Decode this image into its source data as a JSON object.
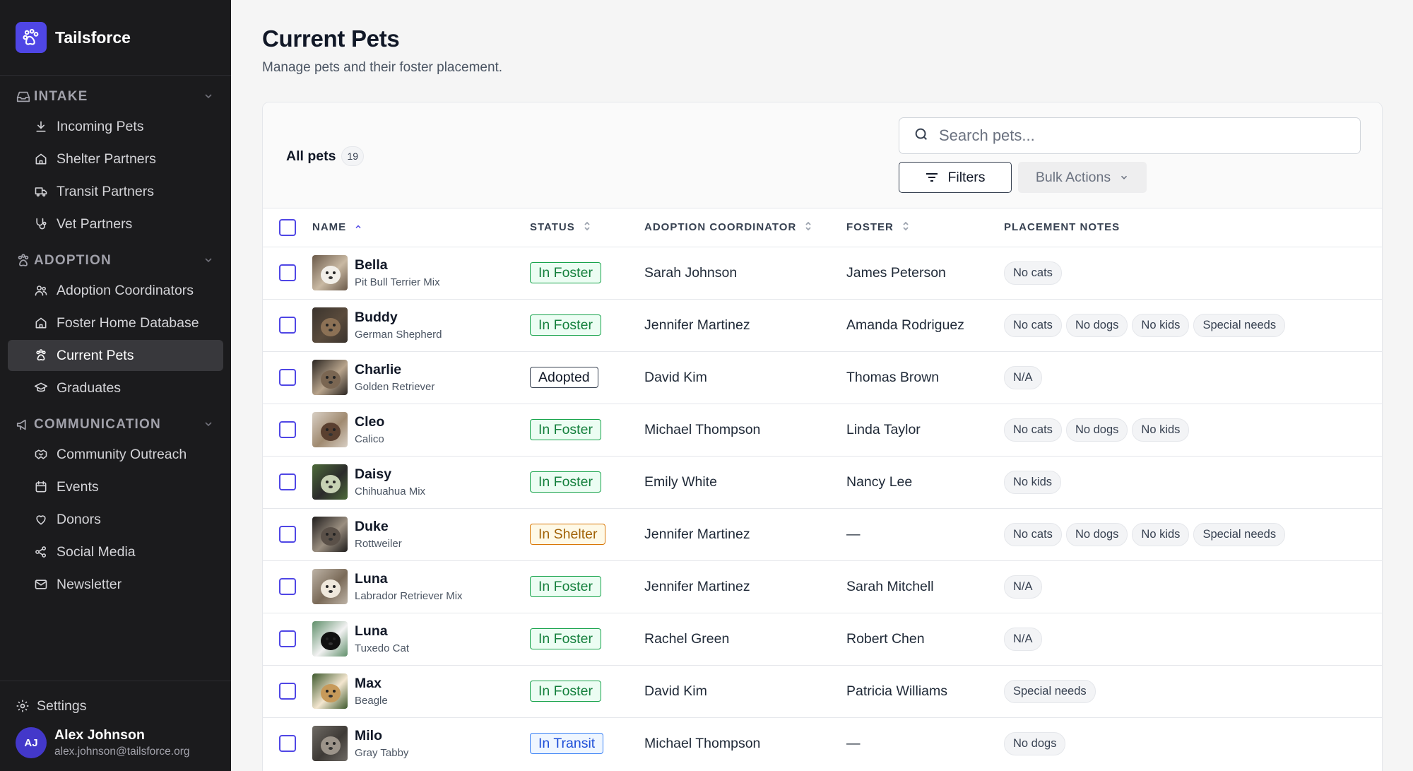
{
  "app": {
    "name": "Tailsforce"
  },
  "sidebar": {
    "sections": [
      {
        "label": "INTAKE",
        "icon": "inbox-icon",
        "items": [
          {
            "label": "Incoming Pets",
            "icon": "download-icon"
          },
          {
            "label": "Shelter Partners",
            "icon": "home-icon"
          },
          {
            "label": "Transit Partners",
            "icon": "truck-icon"
          },
          {
            "label": "Vet Partners",
            "icon": "stethoscope-icon"
          }
        ]
      },
      {
        "label": "ADOPTION",
        "icon": "paw-icon",
        "items": [
          {
            "label": "Adoption Coordinators",
            "icon": "users-icon"
          },
          {
            "label": "Foster Home Database",
            "icon": "home-icon"
          },
          {
            "label": "Current Pets",
            "icon": "paw-icon",
            "active": true
          },
          {
            "label": "Graduates",
            "icon": "graduation-cap-icon"
          }
        ]
      },
      {
        "label": "COMMUNICATION",
        "icon": "megaphone-icon",
        "items": [
          {
            "label": "Community Outreach",
            "icon": "handshake-icon"
          },
          {
            "label": "Events",
            "icon": "calendar-icon"
          },
          {
            "label": "Donors",
            "icon": "heart-icon"
          },
          {
            "label": "Social Media",
            "icon": "share-icon"
          },
          {
            "label": "Newsletter",
            "icon": "mail-icon"
          }
        ]
      }
    ],
    "settings_label": "Settings",
    "user": {
      "initials": "AJ",
      "name": "Alex Johnson",
      "email": "alex.johnson@tailsforce.org"
    }
  },
  "page": {
    "title": "Current Pets",
    "subtitle": "Manage pets and their foster placement."
  },
  "toolbar": {
    "all_label": "All pets",
    "count": "19",
    "search_placeholder": "Search pets...",
    "filters_label": "Filters",
    "bulk_label": "Bulk Actions"
  },
  "table": {
    "columns": [
      "NAME",
      "STATUS",
      "ADOPTION COORDINATOR",
      "FOSTER",
      "PLACEMENT NOTES"
    ],
    "rows": [
      {
        "name": "Bella",
        "breed": "Pit Bull Terrier Mix",
        "status": "In Foster",
        "coordinator": "Sarah Johnson",
        "foster": "James Peterson",
        "notes": [
          "No cats"
        ]
      },
      {
        "name": "Buddy",
        "breed": "German Shepherd",
        "status": "In Foster",
        "coordinator": "Jennifer Martinez",
        "foster": "Amanda Rodriguez",
        "notes": [
          "No cats",
          "No dogs",
          "No kids",
          "Special needs"
        ]
      },
      {
        "name": "Charlie",
        "breed": "Golden Retriever",
        "status": "Adopted",
        "coordinator": "David Kim",
        "foster": "Thomas Brown",
        "notes": [
          "N/A"
        ]
      },
      {
        "name": "Cleo",
        "breed": "Calico",
        "status": "In Foster",
        "coordinator": "Michael Thompson",
        "foster": "Linda Taylor",
        "notes": [
          "No cats",
          "No dogs",
          "No kids"
        ]
      },
      {
        "name": "Daisy",
        "breed": "Chihuahua Mix",
        "status": "In Foster",
        "coordinator": "Emily White",
        "foster": "Nancy Lee",
        "notes": [
          "No kids"
        ]
      },
      {
        "name": "Duke",
        "breed": "Rottweiler",
        "status": "In Shelter",
        "coordinator": "Jennifer Martinez",
        "foster": "—",
        "notes": [
          "No cats",
          "No dogs",
          "No kids",
          "Special needs"
        ]
      },
      {
        "name": "Luna",
        "breed": "Labrador Retriever Mix",
        "status": "In Foster",
        "coordinator": "Jennifer Martinez",
        "foster": "Sarah Mitchell",
        "notes": [
          "N/A"
        ]
      },
      {
        "name": "Luna",
        "breed": "Tuxedo Cat",
        "status": "In Foster",
        "coordinator": "Rachel Green",
        "foster": "Robert Chen",
        "notes": [
          "N/A"
        ]
      },
      {
        "name": "Max",
        "breed": "Beagle",
        "status": "In Foster",
        "coordinator": "David Kim",
        "foster": "Patricia Williams",
        "notes": [
          "Special needs"
        ]
      },
      {
        "name": "Milo",
        "breed": "Gray Tabby",
        "status": "In Transit",
        "coordinator": "Michael Thompson",
        "foster": "—",
        "notes": [
          "No dogs"
        ]
      }
    ]
  },
  "status_styles": {
    "In Foster": {
      "color": "#15803d",
      "bg": "#ecfdf3",
      "border": "#16a34a"
    },
    "Adopted": {
      "color": "#111827",
      "bg": "#ffffff",
      "border": "#374151"
    },
    "In Shelter": {
      "color": "#a16207",
      "bg": "#fef9e7",
      "border": "#d97706"
    },
    "In Transit": {
      "color": "#1d4ed8",
      "bg": "#eff6ff",
      "border": "#3b82f6"
    }
  },
  "colors": {
    "accent": "#4f46e5",
    "sidebar_bg": "#1b1b1d"
  }
}
